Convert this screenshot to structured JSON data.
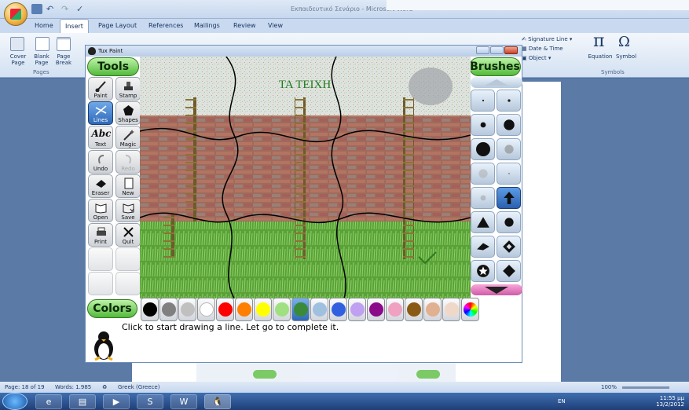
{
  "word": {
    "title": "Εκπαιδευτικό Σενάριο - Microsoft Word",
    "tabs": [
      "Home",
      "Insert",
      "Page Layout",
      "References",
      "Mailings",
      "Review",
      "View"
    ],
    "active_tab": "Insert",
    "ribbon": {
      "cover_page": "Cover Page",
      "blank_page": "Blank Page",
      "page_break": "Page Break",
      "pages_group": "Pages",
      "signature_line": "Signature Line",
      "date_time": "Date & Time",
      "object": "Object",
      "equation": "Equation",
      "symbol": "Symbol",
      "symbols_group": "Symbols",
      "pi_glyph": "π",
      "omega_glyph": "Ω"
    },
    "status": {
      "page": "Page: 18 of 19",
      "words": "Words: 1.985",
      "language": "Greek (Greece)",
      "zoom": "100%"
    }
  },
  "taskbar": {
    "lang": "EN",
    "time": "11:55 μμ",
    "date": "13/2/2012",
    "apps": [
      "ie",
      "explorer",
      "media",
      "skype",
      "word",
      "tuxpaint"
    ]
  },
  "tuxpaint": {
    "title": "Tux Paint",
    "tools_header": "Tools",
    "brushes_header": "Brushes",
    "colors_header": "Colors",
    "tools": [
      {
        "label": "Paint",
        "icon": "paintbrush-icon",
        "state": ""
      },
      {
        "label": "Stamp",
        "icon": "stamp-icon",
        "state": ""
      },
      {
        "label": "Lines",
        "icon": "lines-icon",
        "state": "sel"
      },
      {
        "label": "Shapes",
        "icon": "shapes-icon",
        "state": ""
      },
      {
        "label": "Text",
        "icon": "text-icon",
        "state": "",
        "glyph": "Abc"
      },
      {
        "label": "Magic",
        "icon": "magic-wand-icon",
        "state": ""
      },
      {
        "label": "Undo",
        "icon": "undo-icon",
        "state": ""
      },
      {
        "label": "Redo",
        "icon": "redo-icon",
        "state": "dis"
      },
      {
        "label": "Eraser",
        "icon": "eraser-icon",
        "state": ""
      },
      {
        "label": "New",
        "icon": "new-page-icon",
        "state": ""
      },
      {
        "label": "Open",
        "icon": "open-book-icon",
        "state": ""
      },
      {
        "label": "Save",
        "icon": "save-icon",
        "state": ""
      },
      {
        "label": "Print",
        "icon": "printer-icon",
        "state": ""
      },
      {
        "label": "Quit",
        "icon": "quit-icon",
        "state": ""
      }
    ],
    "canvas_text": "TA TEIXH",
    "colors": [
      "#000000",
      "#808080",
      "#c0c0c0",
      "#ffffff",
      "#ff0000",
      "#ff7f00",
      "#ffff00",
      "#a0e080",
      "#3a8a3a",
      "#a0c0e0",
      "#3060e0",
      "#c0a0f0",
      "#8a0a8a",
      "#f0a0c0",
      "#8a5a14",
      "#e0b090",
      "#f0d8c8",
      "rainbow"
    ],
    "selected_color": 8,
    "info": "Click to start drawing a line. Let go to complete it."
  }
}
